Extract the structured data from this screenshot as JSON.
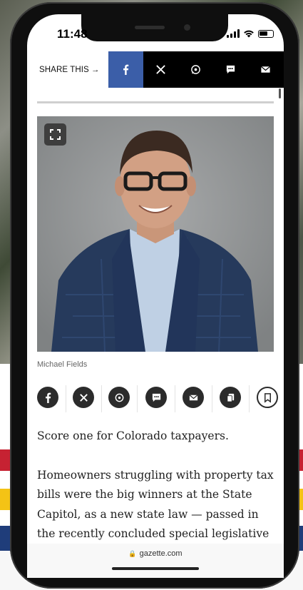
{
  "status": {
    "time": "11:48"
  },
  "sharebar": {
    "label": "SHARE THIS",
    "arrow": "→",
    "buttons": [
      "facebook-icon",
      "x-icon",
      "whatsapp-icon",
      "sms-icon",
      "email-icon"
    ],
    "facebook_color": "#3b5ea8"
  },
  "photo": {
    "caption": "Michael Fields"
  },
  "share_row": {
    "buttons": [
      "facebook-icon",
      "x-icon",
      "whatsapp-icon",
      "sms-icon",
      "email-icon",
      "copy-link-icon",
      "bookmark-icon"
    ]
  },
  "article": {
    "p1": "Score one for Colorado taxpayers.",
    "p2": "Homeowners struggling with property tax bills were the big winners at the State Capitol, as a new state law — passed in the recently concluded special legislative session"
  },
  "urlbar": {
    "url": "gazette.com"
  }
}
